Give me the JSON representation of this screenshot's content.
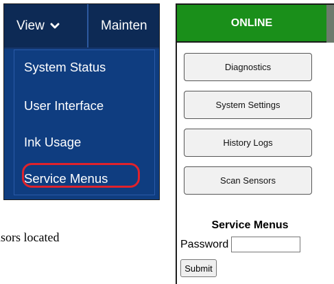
{
  "menu": {
    "view_label": "View",
    "view_icon": "chevron-down-icon",
    "maintenance_label": "Mainten",
    "dropdown_items": [
      {
        "label": "System Status"
      },
      {
        "label": "User Interface"
      },
      {
        "label": "Ink Usage"
      },
      {
        "label": "Service Menus",
        "highlighted": true
      }
    ],
    "highlight_color": "#e0222b",
    "background_color": "#0f3d80"
  },
  "caption": {
    "text": "ensors located"
  },
  "device": {
    "status_label": "ONLINE",
    "status_color": "#1a8f1a",
    "buttons": [
      {
        "label": "Diagnostics"
      },
      {
        "label": "System Settings"
      },
      {
        "label": "History Logs"
      },
      {
        "label": "Scan Sensors"
      }
    ],
    "service_menus_title": "Service Menus",
    "password_label": "Password",
    "password_value": "",
    "submit_label": "Submit"
  }
}
